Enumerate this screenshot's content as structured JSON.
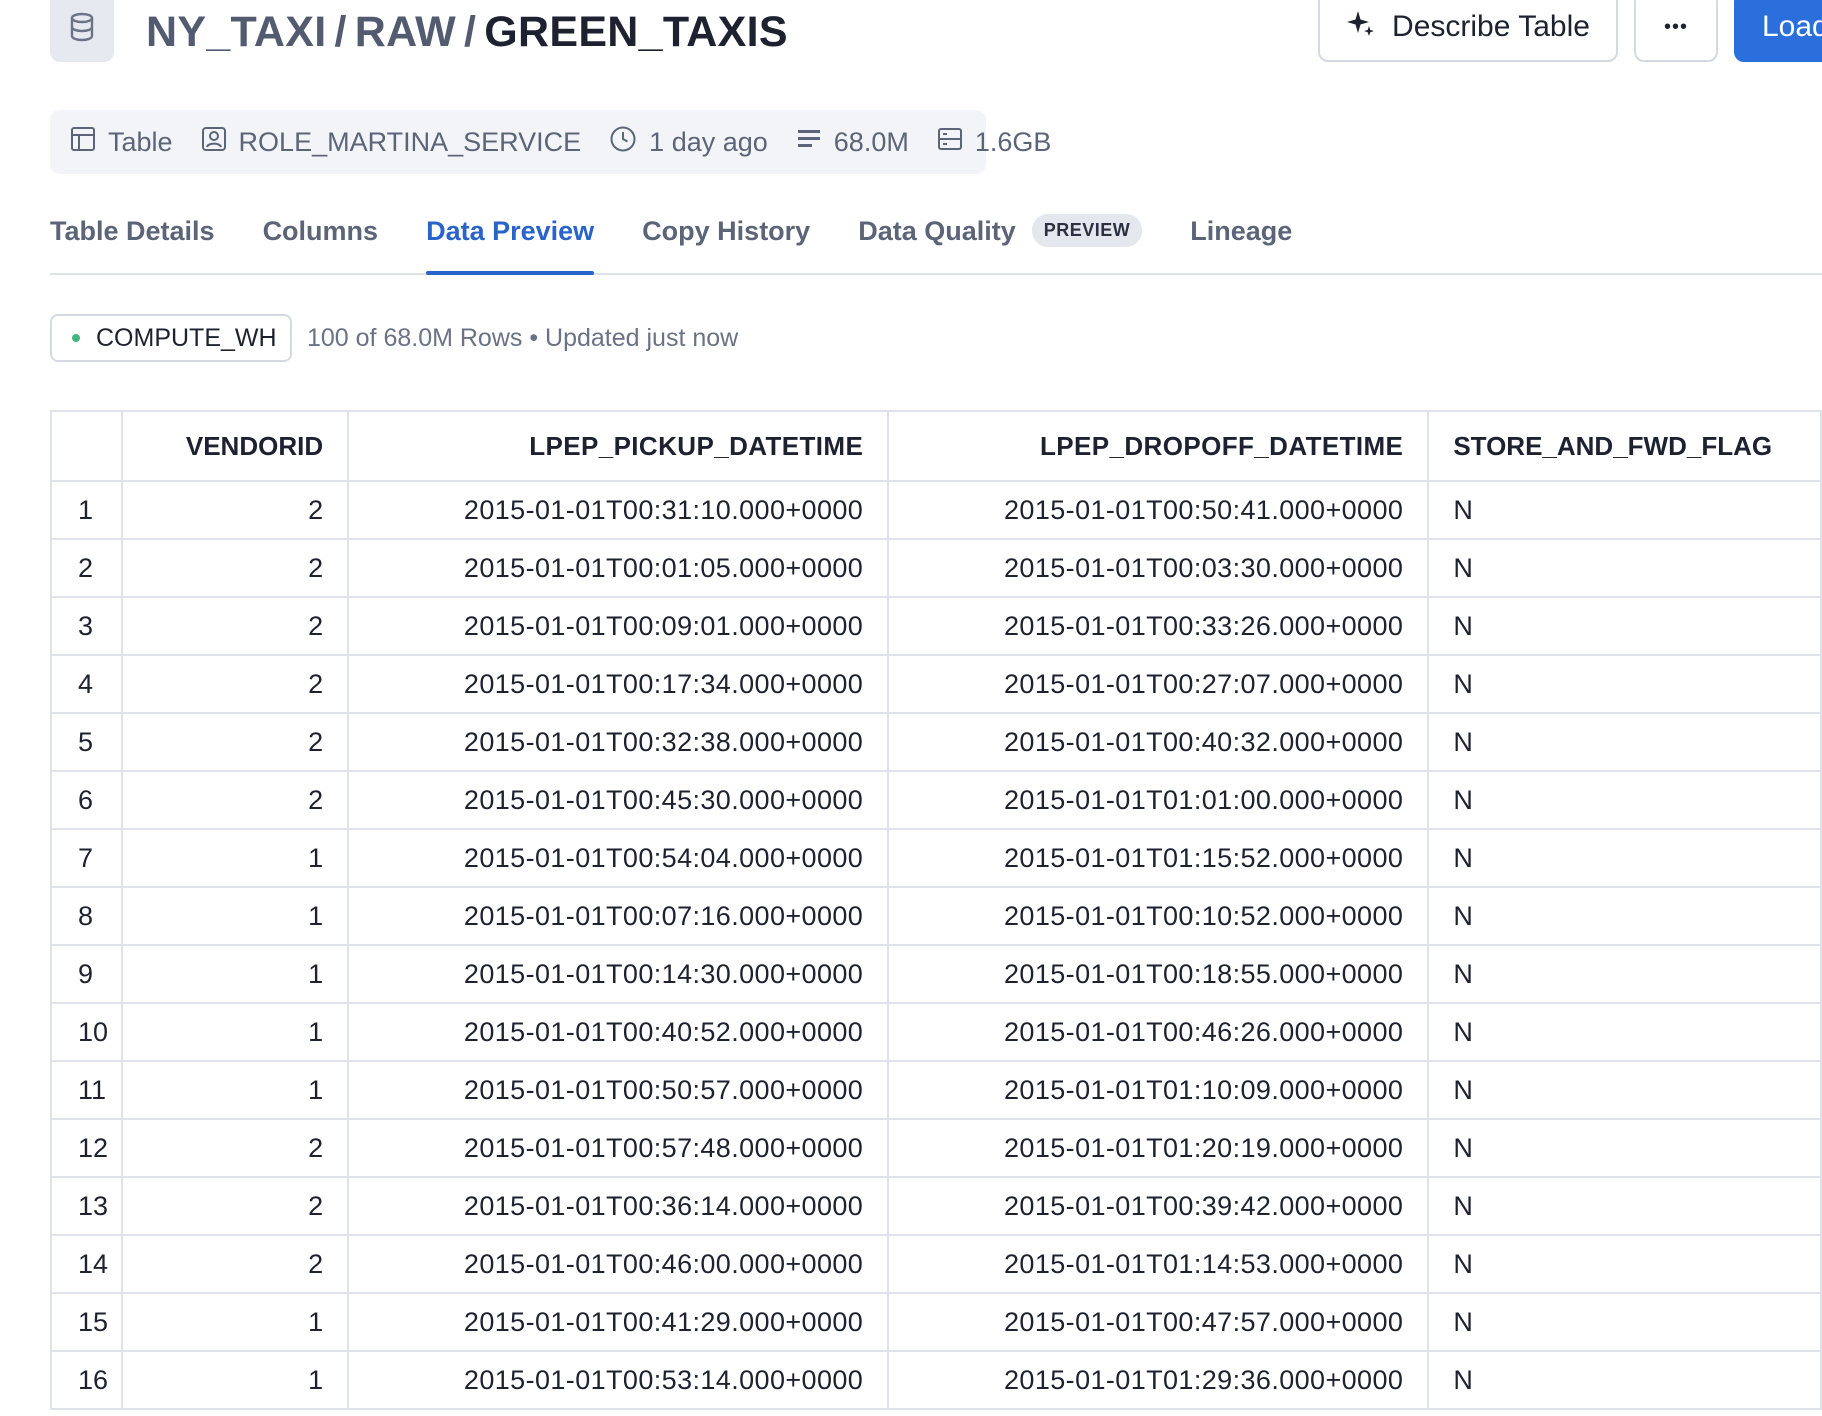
{
  "header": {
    "breadcrumb": [
      "NY_TAXI",
      "RAW"
    ],
    "separator": "/",
    "title": "GREEN_TAXIS",
    "describe_label": "Describe Table",
    "more_label": "•••",
    "load_label": "Load"
  },
  "meta": {
    "type": "Table",
    "owner": "ROLE_MARTINA_SERVICE",
    "updated": "1 day ago",
    "rows": "68.0M",
    "size": "1.6GB"
  },
  "tabs": [
    {
      "label": "Table Details"
    },
    {
      "label": "Columns"
    },
    {
      "label": "Data Preview",
      "active": true
    },
    {
      "label": "Copy History"
    },
    {
      "label": "Data Quality",
      "badge": "PREVIEW"
    },
    {
      "label": "Lineage"
    }
  ],
  "warehouse": {
    "name": "COMPUTE_WH",
    "status": "100 of 68.0M Rows • Updated just now",
    "status_color": "#43b380"
  },
  "table": {
    "columns": [
      "",
      "VENDORID",
      "LPEP_PICKUP_DATETIME",
      "LPEP_DROPOFF_DATETIME",
      "STORE_AND_FWD_FLAG"
    ],
    "rows": [
      [
        "1",
        "2",
        "2015-01-01T00:31:10.000+0000",
        "2015-01-01T00:50:41.000+0000",
        "N"
      ],
      [
        "2",
        "2",
        "2015-01-01T00:01:05.000+0000",
        "2015-01-01T00:03:30.000+0000",
        "N"
      ],
      [
        "3",
        "2",
        "2015-01-01T00:09:01.000+0000",
        "2015-01-01T00:33:26.000+0000",
        "N"
      ],
      [
        "4",
        "2",
        "2015-01-01T00:17:34.000+0000",
        "2015-01-01T00:27:07.000+0000",
        "N"
      ],
      [
        "5",
        "2",
        "2015-01-01T00:32:38.000+0000",
        "2015-01-01T00:40:32.000+0000",
        "N"
      ],
      [
        "6",
        "2",
        "2015-01-01T00:45:30.000+0000",
        "2015-01-01T01:01:00.000+0000",
        "N"
      ],
      [
        "7",
        "1",
        "2015-01-01T00:54:04.000+0000",
        "2015-01-01T01:15:52.000+0000",
        "N"
      ],
      [
        "8",
        "1",
        "2015-01-01T00:07:16.000+0000",
        "2015-01-01T00:10:52.000+0000",
        "N"
      ],
      [
        "9",
        "1",
        "2015-01-01T00:14:30.000+0000",
        "2015-01-01T00:18:55.000+0000",
        "N"
      ],
      [
        "10",
        "1",
        "2015-01-01T00:40:52.000+0000",
        "2015-01-01T00:46:26.000+0000",
        "N"
      ],
      [
        "11",
        "1",
        "2015-01-01T00:50:57.000+0000",
        "2015-01-01T01:10:09.000+0000",
        "N"
      ],
      [
        "12",
        "2",
        "2015-01-01T00:57:48.000+0000",
        "2015-01-01T01:20:19.000+0000",
        "N"
      ],
      [
        "13",
        "2",
        "2015-01-01T00:36:14.000+0000",
        "2015-01-01T00:39:42.000+0000",
        "N"
      ],
      [
        "14",
        "2",
        "2015-01-01T00:46:00.000+0000",
        "2015-01-01T01:14:53.000+0000",
        "N"
      ],
      [
        "15",
        "1",
        "2015-01-01T00:41:29.000+0000",
        "2015-01-01T00:47:57.000+0000",
        "N"
      ],
      [
        "16",
        "1",
        "2015-01-01T00:53:14.000+0000",
        "2015-01-01T01:29:36.000+0000",
        "N"
      ]
    ]
  },
  "colors": {
    "accent": "#2a63c9",
    "primary_button": "#2a6fdb"
  },
  "icons": {
    "db": "database-icon",
    "describe": "sparkle-icon",
    "type": "table-icon",
    "owner": "user-badge-icon",
    "updated": "clock-icon",
    "rows": "rows-icon",
    "size": "storage-icon"
  }
}
